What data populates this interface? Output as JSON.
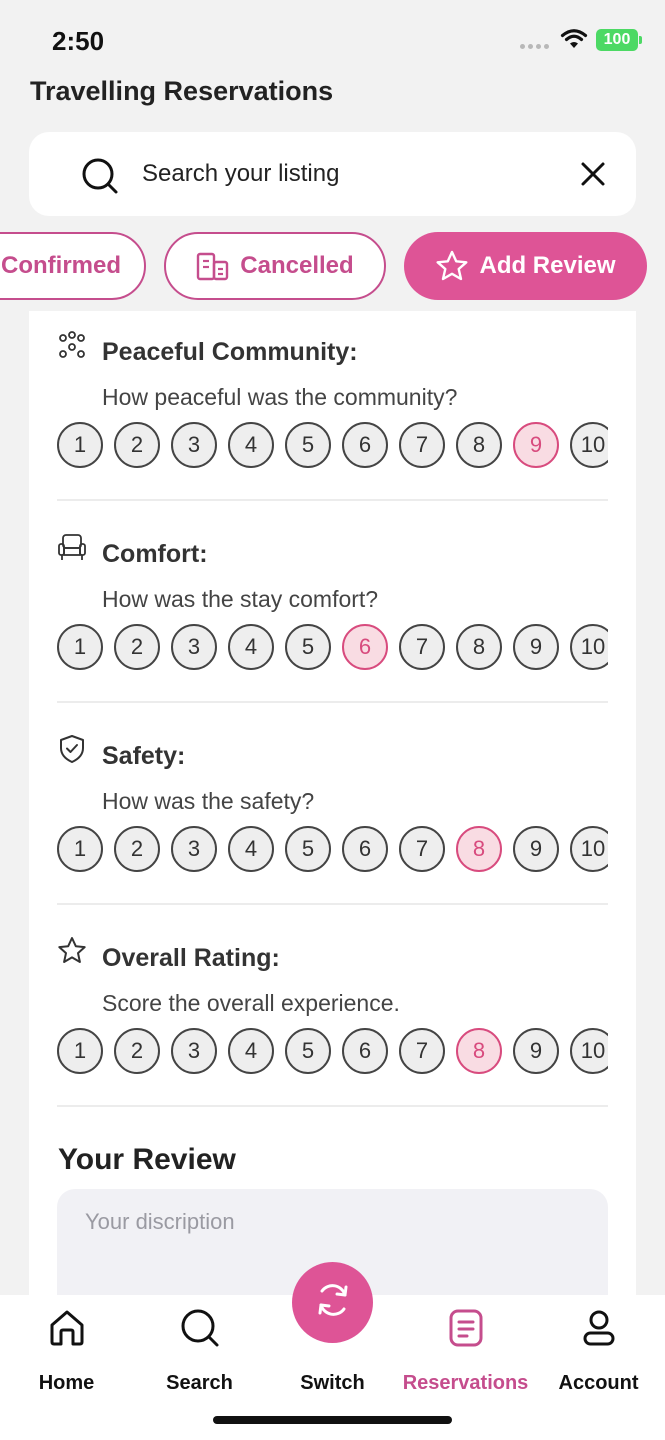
{
  "status_bar": {
    "time": "2:50",
    "battery": "100"
  },
  "header": {
    "title": "Travelling Reservations"
  },
  "search": {
    "placeholder": "Search your listing"
  },
  "tabs": [
    {
      "label": "Confirmed",
      "style": "outline"
    },
    {
      "label": "Cancelled",
      "style": "outline",
      "icon": "building-icon"
    },
    {
      "label": "Add Review",
      "style": "filled",
      "icon": "star-icon"
    }
  ],
  "sections": [
    {
      "title": "Peaceful Community:",
      "question": "How peaceful was the community?",
      "icon": "community-icon",
      "selected": 9
    },
    {
      "title": "Comfort:",
      "question": "How was the stay comfort?",
      "icon": "armchair-icon",
      "selected": 6
    },
    {
      "title": "Safety:",
      "question": "How was the safety?",
      "icon": "shield-icon",
      "selected": 8
    },
    {
      "title": "Overall Rating:",
      "question": "Score the overall experience.",
      "icon": "star-icon",
      "selected": 8
    }
  ],
  "rating_options": [
    "1",
    "2",
    "3",
    "4",
    "5",
    "6",
    "7",
    "8",
    "9",
    "10"
  ],
  "review": {
    "title": "Your Review",
    "placeholder": "Your discription"
  },
  "nav": [
    {
      "label": "Home",
      "icon": "home-icon",
      "active": false
    },
    {
      "label": "Search",
      "icon": "search-icon",
      "active": false
    },
    {
      "label": "Switch",
      "icon": "refresh-icon",
      "active": false
    },
    {
      "label": "Reservations",
      "icon": "document-icon",
      "active": true
    },
    {
      "label": "Account",
      "icon": "user-icon",
      "active": false
    }
  ],
  "colors": {
    "accent": "#de5496",
    "accent_dark": "#c54d8d",
    "selected_fill": "#f9dce3",
    "selected_text": "#d84b7e"
  }
}
